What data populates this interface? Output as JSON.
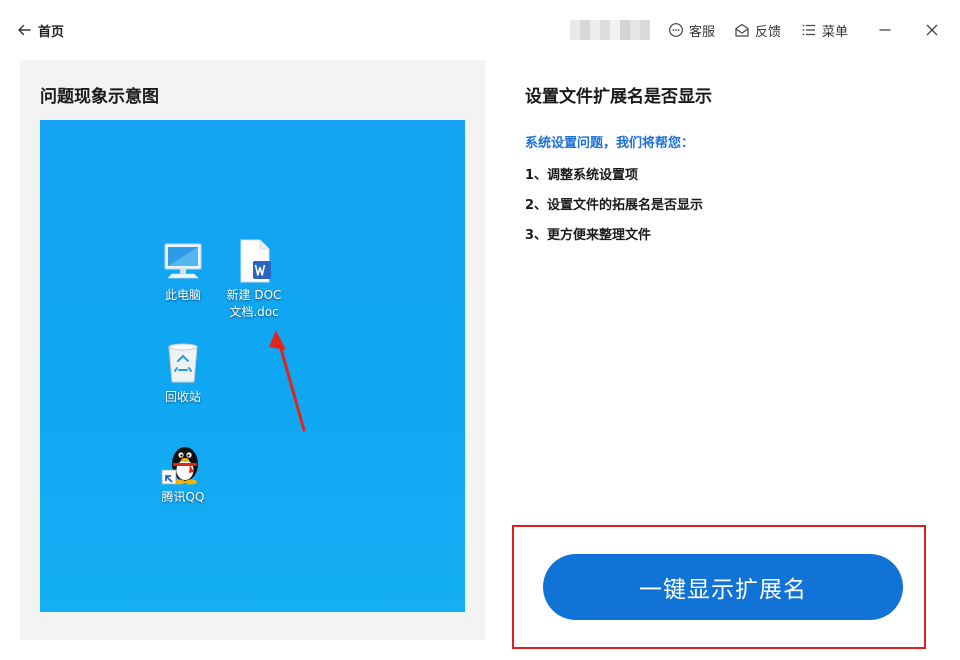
{
  "titlebar": {
    "back_label": "首页",
    "service_label": "客服",
    "feedback_label": "反馈",
    "menu_label": "菜单"
  },
  "left": {
    "title": "问题现象示意图",
    "desktop_icons": [
      {
        "label": "此电脑",
        "icon": "computer-icon"
      },
      {
        "label": "新建 DOC 文档.doc",
        "icon": "word-doc-icon"
      },
      {
        "label": "回收站",
        "icon": "recycle-bin-icon"
      },
      {
        "label": "腾讯QQ",
        "icon": "qq-penguin-icon"
      }
    ]
  },
  "right": {
    "title": "设置文件扩展名是否显示",
    "subtitle": "系统设置问题，我们将帮您：",
    "steps": [
      "1、调整系统设置项",
      "2、设置文件的拓展名是否显示",
      "3、更方便来整理文件"
    ],
    "cta_label": "一键显示扩展名"
  },
  "colors": {
    "accent": "#1273d6",
    "subtitle": "#1e72d8",
    "highlight_border": "#e11d1d",
    "desktop_bg": "#14a8f3",
    "panel_bg": "#f3f3f3"
  }
}
